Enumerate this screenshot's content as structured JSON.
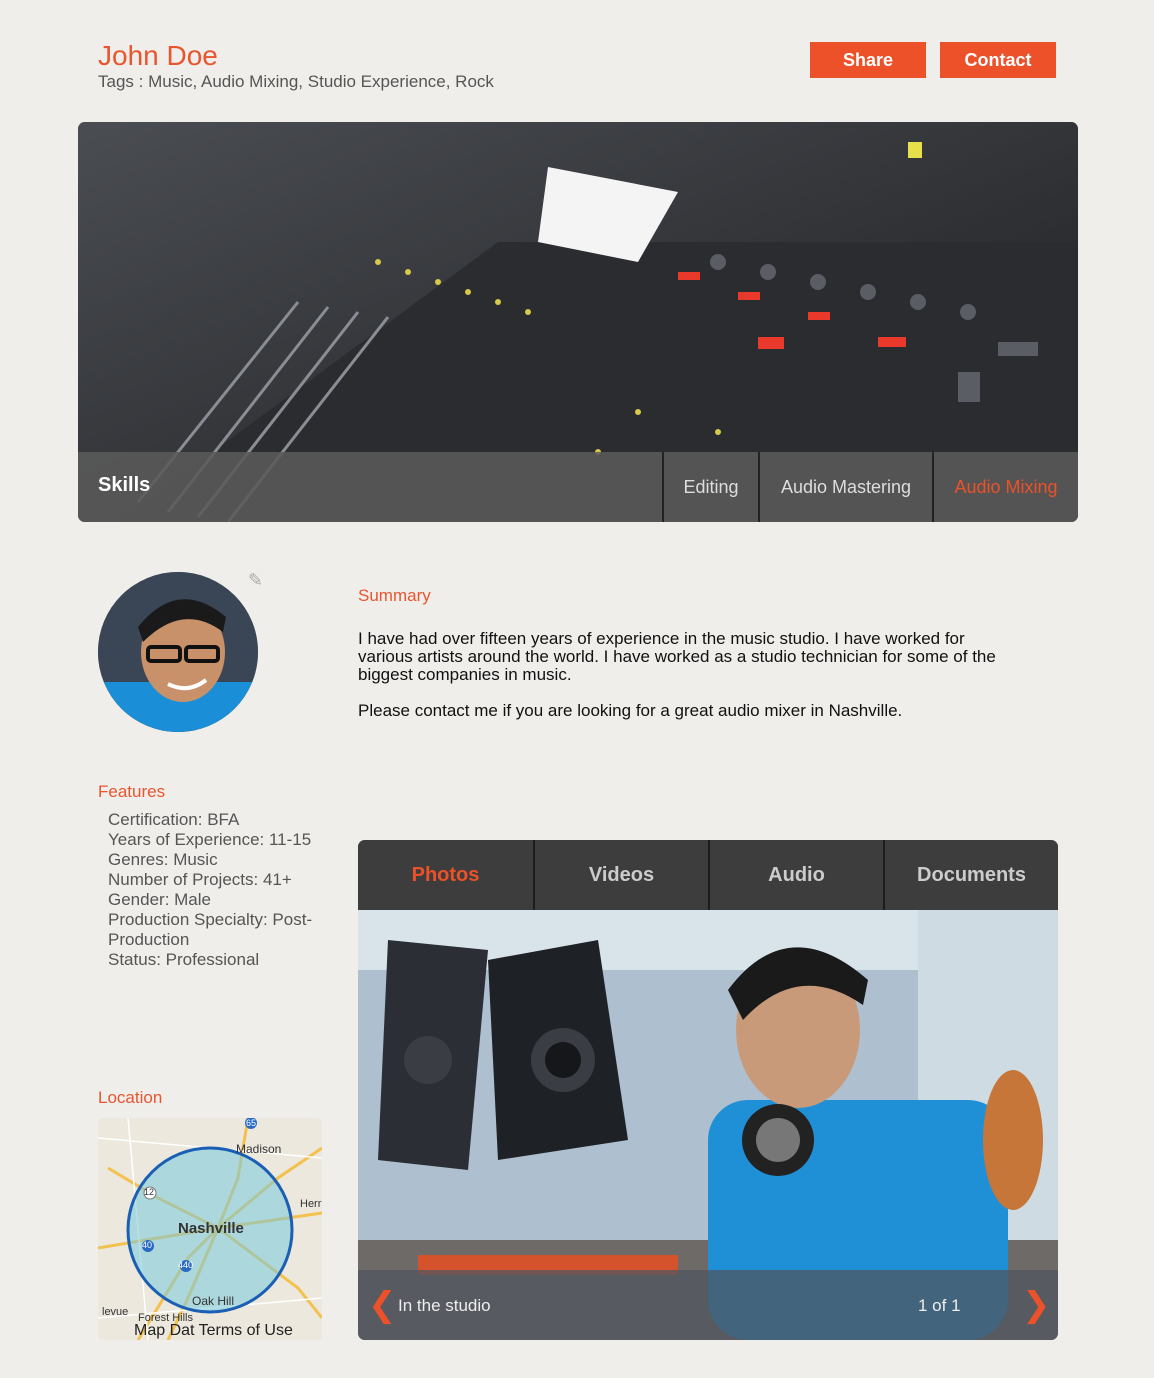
{
  "profile": {
    "name": "John Doe",
    "tags": "Tags : Music, Audio Mixing, Studio Experience, Rock"
  },
  "actions": {
    "share": "Share",
    "contact": "Contact"
  },
  "skills": {
    "title": "Skills",
    "items": [
      "Editing",
      "Audio Mastering",
      "Audio Mixing"
    ],
    "active": "Audio Mixing"
  },
  "summary": {
    "title": "Summary",
    "p1": "I have had over fifteen years of experience in the music studio.  I have worked for various artists around the world.  I have worked as a studio technician for some of the biggest companies in music.",
    "p2": "Please contact me if you are looking for a great audio mixer in Nashville."
  },
  "features": {
    "title": "Features",
    "items": [
      "Certification: BFA",
      "Years of Experience: 11-15",
      "Genres: Music",
      "Number of Projects: 41+",
      "Gender: Male",
      "Production Specialty: Post-Production",
      "Status: Professional"
    ]
  },
  "location": {
    "title": "Location",
    "map_labels": [
      "Madison",
      "Nashville",
      "Oak Hill",
      "Forest Hills",
      "Herr",
      "levue",
      "65",
      "12",
      "40",
      "440"
    ],
    "map_footer": "Map Dat Terms of Use"
  },
  "media": {
    "tabs": [
      "Photos",
      "Videos",
      "Audio",
      "Documents"
    ],
    "active_tab": "Photos",
    "caption": "In the studio",
    "counter": "1 of 1"
  },
  "colors": {
    "accent": "#ec5129",
    "background": "#efeeea"
  },
  "icons": {
    "edit": "pencil-icon",
    "prev": "chevron-left-icon",
    "next": "chevron-right-icon"
  }
}
